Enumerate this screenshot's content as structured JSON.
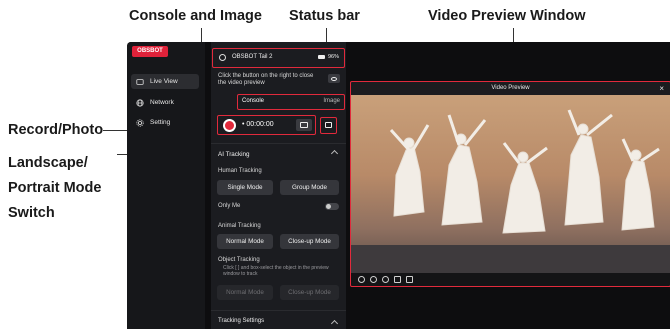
{
  "callouts": {
    "console_image": "Console and Image",
    "status_bar": "Status bar",
    "video_preview": "Video Preview Window",
    "record_photo": "Record/Photo",
    "landscape_line1": "Landscape/",
    "landscape_line2": "Portrait Mode",
    "landscape_line3": "Switch"
  },
  "app": {
    "logo": "OBSBOT",
    "sidebar": [
      {
        "label": "Live View",
        "icon": "live-view-icon",
        "active": true
      },
      {
        "label": "Network",
        "icon": "globe-icon",
        "active": false
      },
      {
        "label": "Setting",
        "icon": "gear-icon",
        "active": false
      }
    ],
    "status": {
      "device": "OBSBOT Tail 2",
      "battery": "96%"
    },
    "preview_hint": "Click the button on the right to close the video preview",
    "tabs": {
      "console": "Console",
      "image": "Image"
    },
    "record": {
      "time": "• 00:00:00"
    },
    "ai_tracking": {
      "title": "AI Tracking",
      "human": {
        "label": "Human Tracking",
        "single": "Single Mode",
        "group": "Group Mode"
      },
      "only_me": "Only Me",
      "animal": {
        "label": "Animal Tracking",
        "normal": "Normal Mode",
        "closeup": "Close-up Mode"
      },
      "object": {
        "label": "Object Tracking",
        "hint": "Click [ ] and box-select the object in the preview window to track",
        "normal": "Normal Mode",
        "closeup": "Close-up Mode"
      },
      "tracking_settings": "Tracking Settings"
    },
    "video": {
      "title": "Video Preview",
      "close": "×"
    }
  },
  "colors": {
    "accent": "#e12a3c",
    "panel": "#1b1c20",
    "sidebar": "#16171a"
  }
}
